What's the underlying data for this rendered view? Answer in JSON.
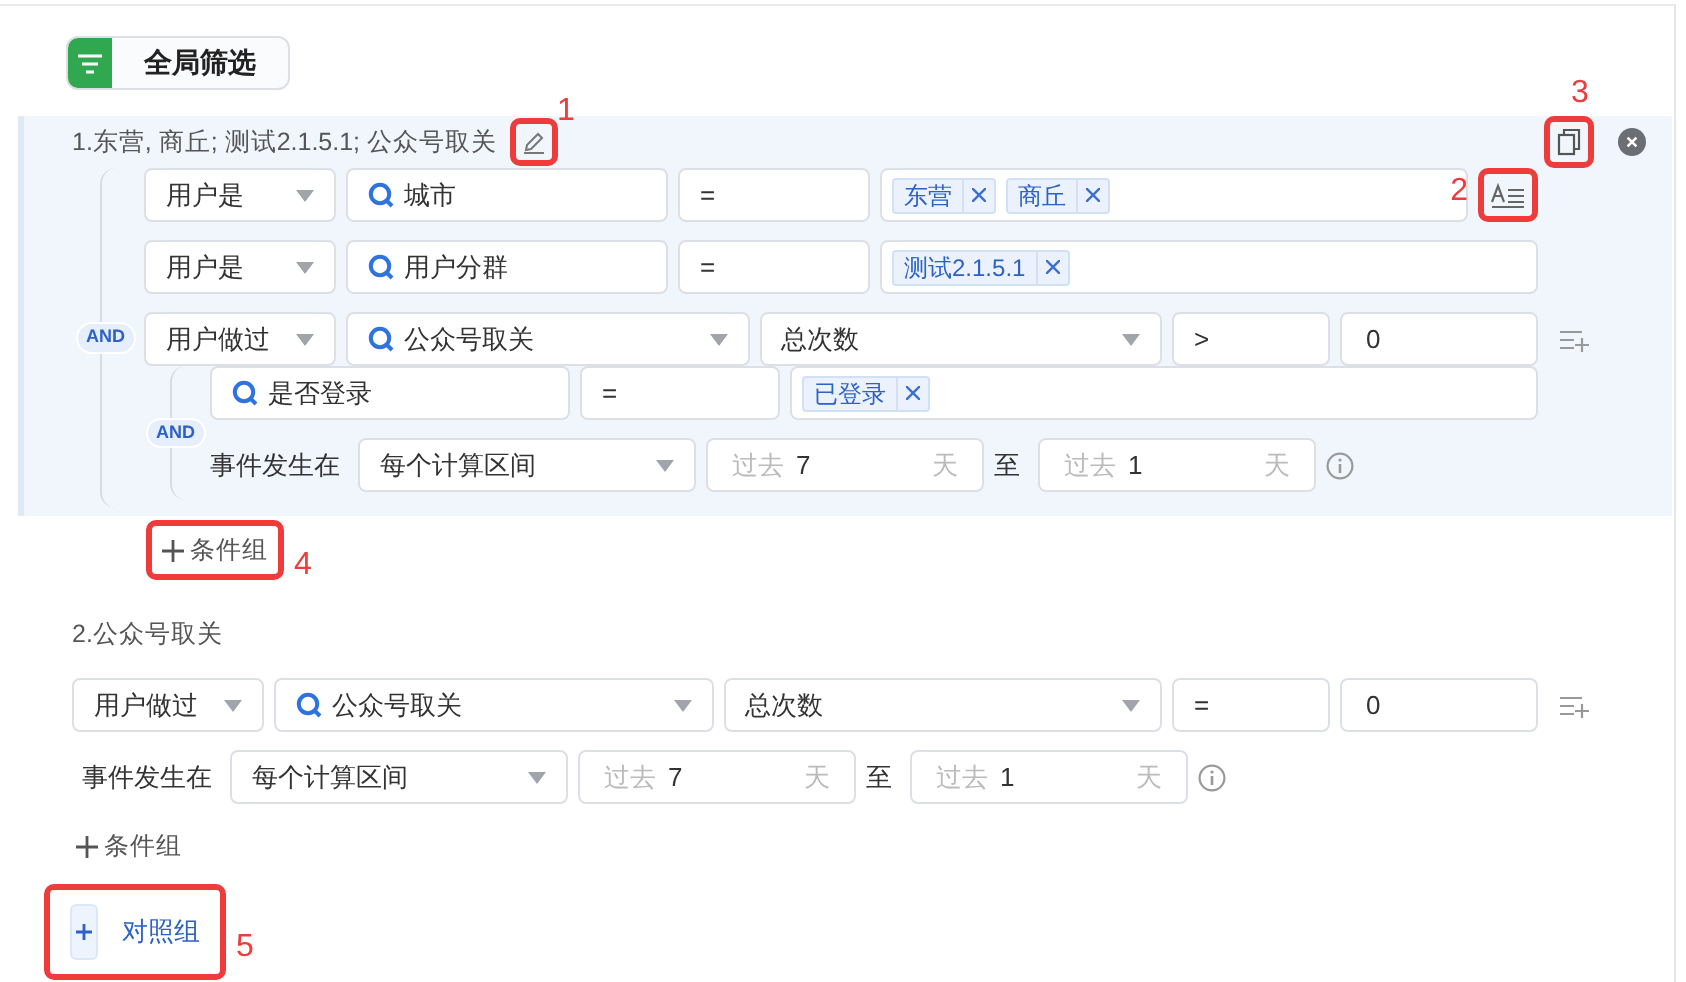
{
  "header": {
    "label": "全局筛选"
  },
  "groups": [
    {
      "title": "1.东营, 商丘; 测试2.1.5.1; 公众号取关",
      "highlighted": true,
      "edit": {
        "annotation": {
          "label": "1"
        }
      },
      "actions": [
        {
          "kind": "copy",
          "annotation": {
            "label": "3"
          }
        },
        {
          "kind": "close"
        }
      ],
      "logic": "AND",
      "rows": [
        {
          "kind": "property",
          "subject": "用户是",
          "field": "城市",
          "operator": "=",
          "tags": [
            "东营",
            "商丘"
          ],
          "tool": {
            "kind": "format",
            "annotation": {
              "label": "2"
            }
          }
        },
        {
          "kind": "property",
          "subject": "用户是",
          "field": "用户分群",
          "operator": "=",
          "tags": [
            "测试2.1.5.1"
          ]
        },
        {
          "kind": "event",
          "subject": "用户做过",
          "event": "公众号取关",
          "metric": "总次数",
          "operator": ">",
          "value": "0",
          "tool": {
            "kind": "add_filter"
          },
          "logic": "AND",
          "filters": [
            {
              "field": "是否登录",
              "operator": "=",
              "tags": [
                "已登录"
              ]
            }
          ],
          "time": {
            "label": "事件发生在",
            "range": "每个计算区间",
            "from": {
              "prefix": "过去",
              "value": "7",
              "unit": "天"
            },
            "joiner": "至",
            "to": {
              "prefix": "过去",
              "value": "1",
              "unit": "天"
            }
          }
        }
      ],
      "add_group": {
        "label": "条件组",
        "annotation": {
          "label": "4"
        }
      }
    },
    {
      "title": "2.公众号取关",
      "highlighted": false,
      "rows": [
        {
          "kind": "event",
          "subject": "用户做过",
          "event": "公众号取关",
          "metric": "总次数",
          "operator": "=",
          "value": "0",
          "tool": {
            "kind": "add_filter"
          },
          "time": {
            "label": "事件发生在",
            "range": "每个计算区间",
            "from": {
              "prefix": "过去",
              "value": "7",
              "unit": "天"
            },
            "joiner": "至",
            "to": {
              "prefix": "过去",
              "value": "1",
              "unit": "天"
            }
          }
        }
      ],
      "add_group": {
        "label": "条件组"
      }
    }
  ],
  "compare_button": {
    "label": "对照组",
    "annotation": {
      "label": "5"
    }
  }
}
